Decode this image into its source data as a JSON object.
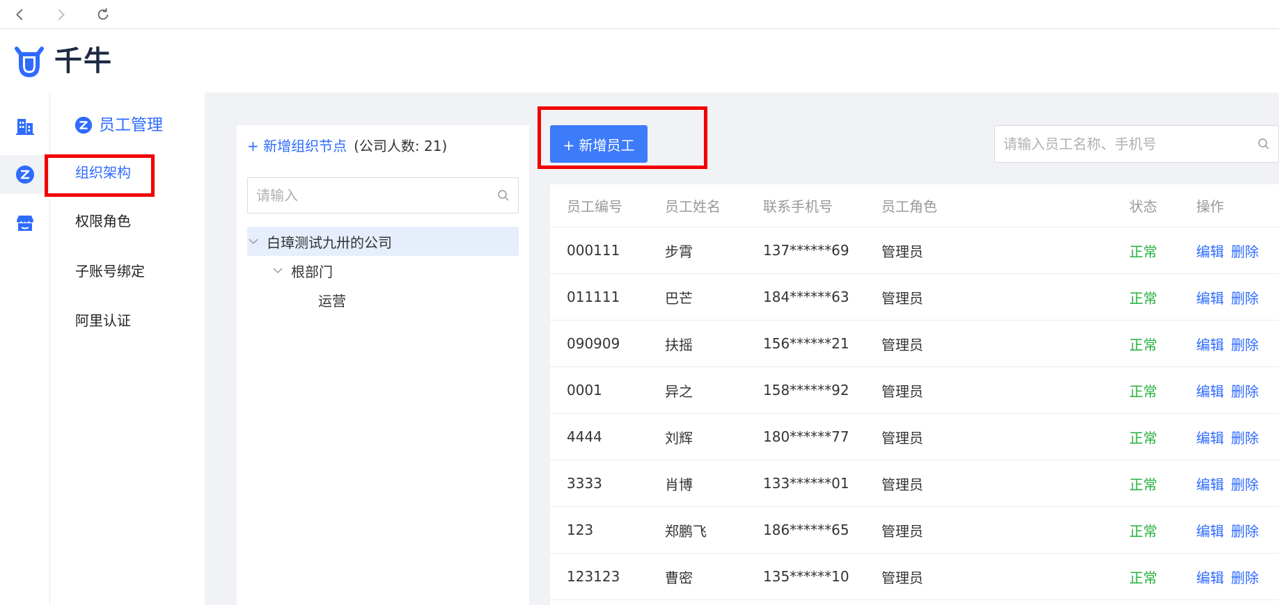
{
  "browser": {
    "back_icon": "chevron-left-icon",
    "forward_icon": "chevron-right-icon",
    "reload_icon": "reload-icon"
  },
  "app": {
    "logo_text": "千牛",
    "brand_color": "#2f6bff"
  },
  "rail": {
    "items": [
      {
        "icon": "building-icon"
      },
      {
        "icon": "employee-icon",
        "active": true
      },
      {
        "icon": "store-icon"
      }
    ]
  },
  "side_nav": {
    "title": "员工管理",
    "items": [
      {
        "label": "组织架构",
        "active": true
      },
      {
        "label": "权限角色"
      },
      {
        "label": "子账号绑定"
      },
      {
        "label": "阿里认证"
      }
    ]
  },
  "org_tree": {
    "add_label": "+ 新增组织节点",
    "count_label": "(公司人数: 21)",
    "search_placeholder": "请输入",
    "nodes": [
      {
        "label": "白璋测试九卅的公司",
        "level": 0,
        "expanded": true,
        "selected": true
      },
      {
        "label": "根部门",
        "level": 1,
        "expanded": true
      },
      {
        "label": "运营",
        "level": 2
      }
    ]
  },
  "toolbar": {
    "add_employee_label": "+ 新增员工",
    "search_placeholder": "请输入员工名称、手机号"
  },
  "table": {
    "columns": [
      "员工编号",
      "员工姓名",
      "联系手机号",
      "员工角色",
      "状态",
      "操作"
    ],
    "rows": [
      {
        "id": "000111",
        "name": "步霄",
        "phone": "137******69",
        "role": "管理员",
        "status": "正常",
        "edit": "编辑",
        "delete": "删除"
      },
      {
        "id": "011111",
        "name": "巴芒",
        "phone": "184******63",
        "role": "管理员",
        "status": "正常",
        "edit": "编辑",
        "delete": "删除"
      },
      {
        "id": "090909",
        "name": "扶摇",
        "phone": "156******21",
        "role": "管理员",
        "status": "正常",
        "edit": "编辑",
        "delete": "删除"
      },
      {
        "id": "0001",
        "name": "异之",
        "phone": "158******92",
        "role": "管理员",
        "status": "正常",
        "edit": "编辑",
        "delete": "删除"
      },
      {
        "id": "4444",
        "name": "刘辉",
        "phone": "180******77",
        "role": "管理员",
        "status": "正常",
        "edit": "编辑",
        "delete": "删除"
      },
      {
        "id": "3333",
        "name": "肖博",
        "phone": "133******01",
        "role": "管理员",
        "status": "正常",
        "edit": "编辑",
        "delete": "删除"
      },
      {
        "id": "123",
        "name": "郑鹏飞",
        "phone": "186******65",
        "role": "管理员",
        "status": "正常",
        "edit": "编辑",
        "delete": "删除"
      },
      {
        "id": "123123",
        "name": "曹密",
        "phone": "135******10",
        "role": "管理员",
        "status": "正常",
        "edit": "编辑",
        "delete": "删除"
      }
    ]
  },
  "colors": {
    "status_ok": "#25b03d",
    "primary_button": "#3c7bfa",
    "annotation_box": "#f20000"
  }
}
